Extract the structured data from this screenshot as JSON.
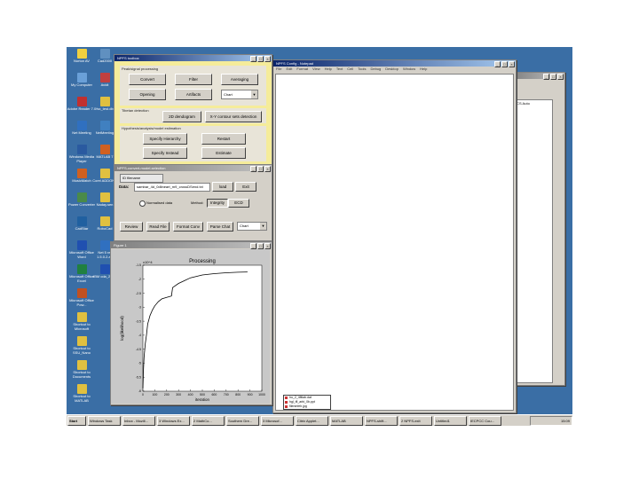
{
  "desktop_icons": [
    {
      "label": "Norton AV",
      "color": "#f0d040"
    },
    {
      "label": "My Computer",
      "color": "#6aa0d8"
    },
    {
      "label": "Adobe Reader 7.0",
      "color": "#c03030"
    },
    {
      "label": "Net Meeting",
      "color": "#3070c0"
    },
    {
      "label": "Windows Media Player",
      "color": "#2a5aa0"
    },
    {
      "label": "MusicMatch",
      "color": "#d06020"
    },
    {
      "label": "Power Converter",
      "color": "#4a8a4a"
    },
    {
      "label": "CadStar",
      "color": "#2060a0"
    },
    {
      "label": "Microsoft Office Word",
      "color": "#2050b0"
    },
    {
      "label": "Microsoft Office Excel",
      "color": "#208040"
    },
    {
      "label": "Microsoft Office Pow...",
      "color": "#c05020"
    },
    {
      "label": "Shortcut to Microsoft",
      "color": "#e0c040"
    },
    {
      "label": "Shortcut to SSU_Nano",
      "color": "#e0c040"
    },
    {
      "label": "Shortcut to Documents",
      "color": "#e0c040"
    },
    {
      "label": "Shortcut to MATLAB",
      "color": "#e0c040"
    }
  ],
  "desktop_icons_col2": [
    {
      "label": "Cad2000",
      "color": "#6090c0"
    },
    {
      "label": "Avidt",
      "color": "#c04040"
    },
    {
      "label": "fsx_test.db",
      "color": "#e0c040"
    },
    {
      "label": "NetMeeting",
      "color": "#4080c0"
    },
    {
      "label": "MATLAB 7",
      "color": "#d06020"
    },
    {
      "label": "Corel ADDONS",
      "color": "#e0c040"
    },
    {
      "label": "Naday.sen",
      "color": "#e0c040"
    },
    {
      "label": "RoboCad",
      "color": "#e0c040"
    },
    {
      "label": "Net 5 ref 1.5.0.2.ad",
      "color": "#3070c0"
    },
    {
      "label": "IBM cda_2008",
      "color": "#2050b0"
    }
  ],
  "toolbox_window": {
    "title": "NPFS toolbox",
    "panel1_label": "Peak/signal processing",
    "buttons": [
      "Convert",
      "Filter",
      "Averaging",
      "Opening",
      "Artifacts"
    ],
    "select_value": "Chart",
    "panel2_label": "Tibetan detection",
    "panel2_buttons": [
      "2D dendogram",
      "X-Y contour sets detection"
    ],
    "panel3_label": "Hypothesis/analysis/model estimation",
    "panel3_buttons": [
      "Specify Hierarchy",
      "Restart",
      "Specify Instead",
      "Estimate"
    ]
  },
  "config_window": {
    "title": "NPFS-convert-model-selection",
    "label": "ID filename",
    "data_label": "Data:",
    "path_value": "sambar_4d_0dlineart_m9_crossDSend.txt",
    "load_label": "load",
    "exit_label": "Exit",
    "radio_label": "Normalised data",
    "method_label": "Method:",
    "method_options": [
      "Integrity",
      "ECD"
    ],
    "bottom_buttons": [
      "Review",
      "Read File",
      "Format Conv",
      "Parse Chat"
    ],
    "bottom_select": "Chart"
  },
  "plot_window": {
    "title": "Figure 1"
  },
  "editor_window": {
    "title": "NPFS Config - Notepad",
    "menu": [
      "File",
      "Edit",
      "Format",
      "View",
      "Help",
      "Text",
      "Cell",
      "Tools",
      "Debug",
      "Desktop",
      "Window",
      "Help"
    ]
  },
  "back_window": {
    "title": "",
    "content_text": "ICS Auto"
  },
  "chart_data": {
    "type": "line",
    "title": "Processing",
    "xlabel": "iteration",
    "ylabel": "log(likelihood)",
    "y_multiplier": "x10^4",
    "xlim": [
      0,
      1000
    ],
    "ylim": [
      -6,
      -1.5
    ],
    "x_ticks": [
      "0",
      "100",
      "200",
      "300",
      "400",
      "500",
      "600",
      "700",
      "800",
      "900",
      "1000"
    ],
    "y_ticks": [
      "-1.5",
      "-2",
      "-2.5",
      "-3",
      "-3.5",
      "-4",
      "-4.5",
      "-5",
      "-5.5",
      "-6"
    ],
    "series": [
      {
        "x": [
          0,
          5,
          10,
          20,
          30,
          40,
          60,
          80,
          100,
          130,
          160,
          200,
          240,
          250,
          300,
          350,
          400,
          500,
          600,
          700,
          800,
          880
        ],
        "y": [
          -5.9,
          -5.2,
          -4.8,
          -4.3,
          -4.0,
          -3.6,
          -3.3,
          -3.1,
          -2.95,
          -2.8,
          -2.7,
          -2.65,
          -2.6,
          -2.3,
          -2.15,
          -2.05,
          -1.95,
          -1.85,
          -1.8,
          -1.77,
          -1.75,
          -1.74
        ]
      }
    ],
    "grid": false
  },
  "taskbar": {
    "start_label": "Start",
    "items": [
      "Windows Task",
      "Inbox - Mozill...",
      "3 Windows Ex...",
      "2 MathCo...",
      "Southern Dre...",
      "3 Microsof...",
      "Citrix Applet...",
      "MATLAB",
      "NPFS-shift...",
      "2 NPFS-exit",
      "Untitled1",
      "IECPCC Cou..."
    ],
    "clock": "15:09"
  },
  "popup_menu": {
    "items": [
      "ho_2_4fitlab.dat",
      "hgl_tfl_arbi_0b.ppt",
      "filenmfeh.jpg"
    ]
  }
}
